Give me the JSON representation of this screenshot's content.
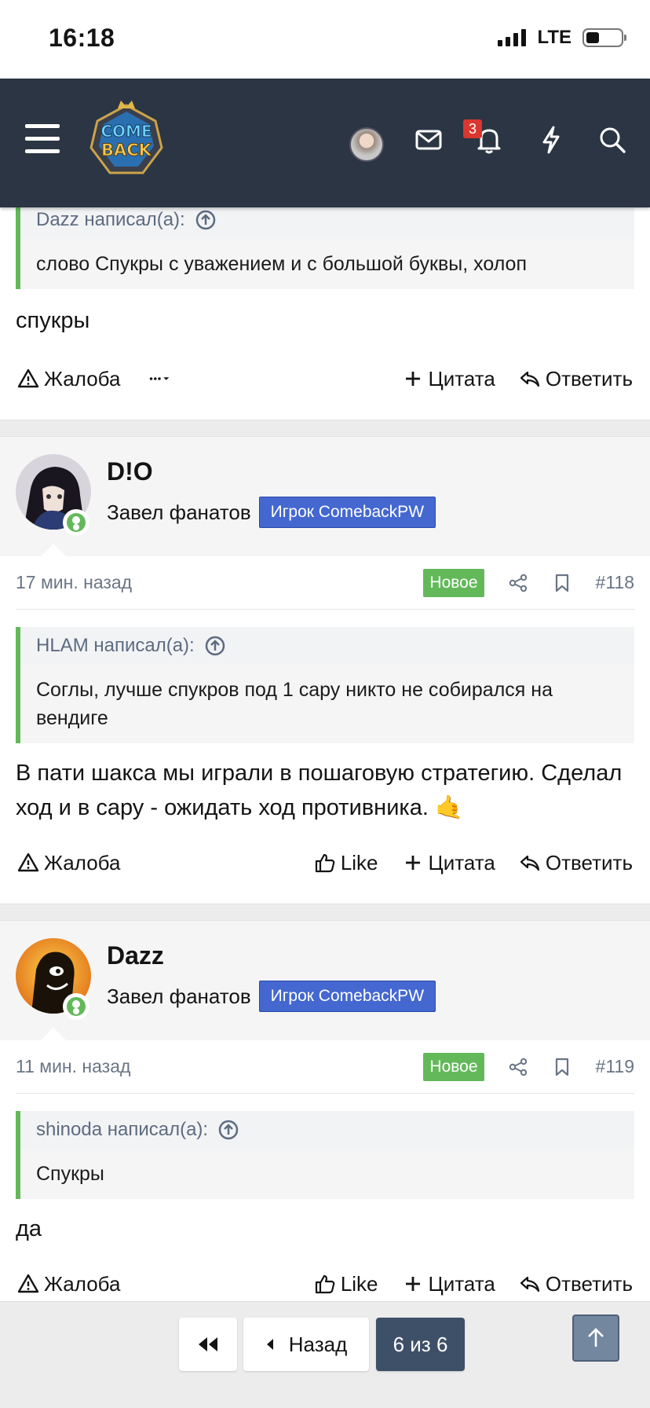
{
  "status_bar": {
    "time": "16:18",
    "network": "LTE"
  },
  "header": {
    "notification_count": "3"
  },
  "top_post": {
    "quote_author": "Dazz написал(а):",
    "quote_text": "слово Спукры с уважением и с большой буквы, холоп",
    "message": "спукры",
    "actions": {
      "report": "Жалоба",
      "quote": "Цитата",
      "reply": "Ответить"
    }
  },
  "posts": [
    {
      "username": "D!O",
      "user_title": "Завел фанатов",
      "user_banner": "Игрок ComebackPW",
      "time": "17 мин. назад",
      "new_label": "Новое",
      "number": "#118",
      "quote_author": "HLAM написал(а):",
      "quote_text": "Соглы, лучше спукров под 1 сару никто не собирался на вендиге",
      "message": "В пати шакса мы играли в пошаговую стратегию. Сделал ход и в сару - ожидать ход противника. 🤙",
      "actions": {
        "report": "Жалоба",
        "like": "Like",
        "quote": "Цитата",
        "reply": "Ответить"
      }
    },
    {
      "username": "Dazz",
      "user_title": "Завел фанатов",
      "user_banner": "Игрок ComebackPW",
      "time": "11 мин. назад",
      "new_label": "Новое",
      "number": "#119",
      "quote_author": "shinoda написал(а):",
      "quote_text": "Спукры",
      "message": "да",
      "actions": {
        "report": "Жалоба",
        "like": "Like",
        "quote": "Цитата",
        "reply": "Ответить"
      }
    }
  ],
  "pagination": {
    "back_label": "Назад",
    "current": "6 из 6"
  },
  "colors": {
    "header_bg": "#2b3543",
    "accent_green": "#63b95a",
    "banner_blue": "#4468d0",
    "pager_current": "#3e5068"
  },
  "icons": [
    "menu-icon",
    "mail-icon",
    "bell-icon",
    "bolt-icon",
    "search-icon",
    "warning-icon",
    "more-icon",
    "plus-icon",
    "reply-icon",
    "thumbs-up-icon",
    "share-icon",
    "bookmark-icon",
    "arrow-up-circle-icon",
    "first-page-icon",
    "caret-left-icon",
    "arrow-up-icon"
  ]
}
